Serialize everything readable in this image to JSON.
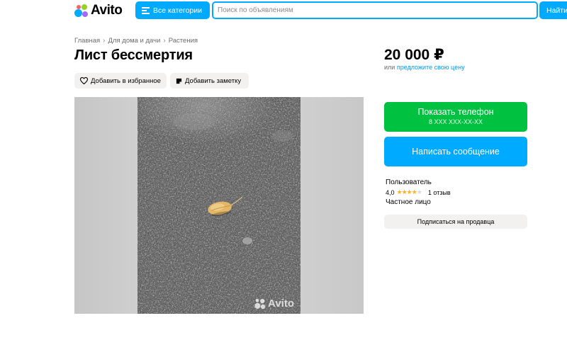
{
  "header": {
    "logo_text": "Avito",
    "categories_label": "Все категории",
    "search_placeholder": "Поиск по объявлениям",
    "search_button": "Найти"
  },
  "breadcrumb": [
    "Главная",
    "Для дома и дачи",
    "Растения"
  ],
  "title": "Лист бессмертия",
  "actions": {
    "favorite_label": "Добавить в избранное",
    "note_label": "Добавить заметку"
  },
  "gallery": {
    "watermark": "Avito",
    "photo_subject": "leaf-on-asphalt"
  },
  "price": {
    "value": "20 000 ₽",
    "prefix": "или",
    "offer_link": "предложите свою цену"
  },
  "contact": {
    "phone_button": "Показать телефон",
    "phone_masked": "8 XXX XXX-XX-XX",
    "message_button": "Написать сообщение"
  },
  "seller": {
    "name": "Пользователь",
    "rating": "4,0",
    "stars_filled": 4,
    "stars_total": 5,
    "reviews": "1 отзыв",
    "type": "Частное лицо",
    "subscribe_button": "Подписаться на продавца"
  },
  "colors": {
    "accent": "#00aaff",
    "phone_green": "#00c140",
    "star": "#ffb021",
    "chip_bg": "#f2f1f0"
  }
}
